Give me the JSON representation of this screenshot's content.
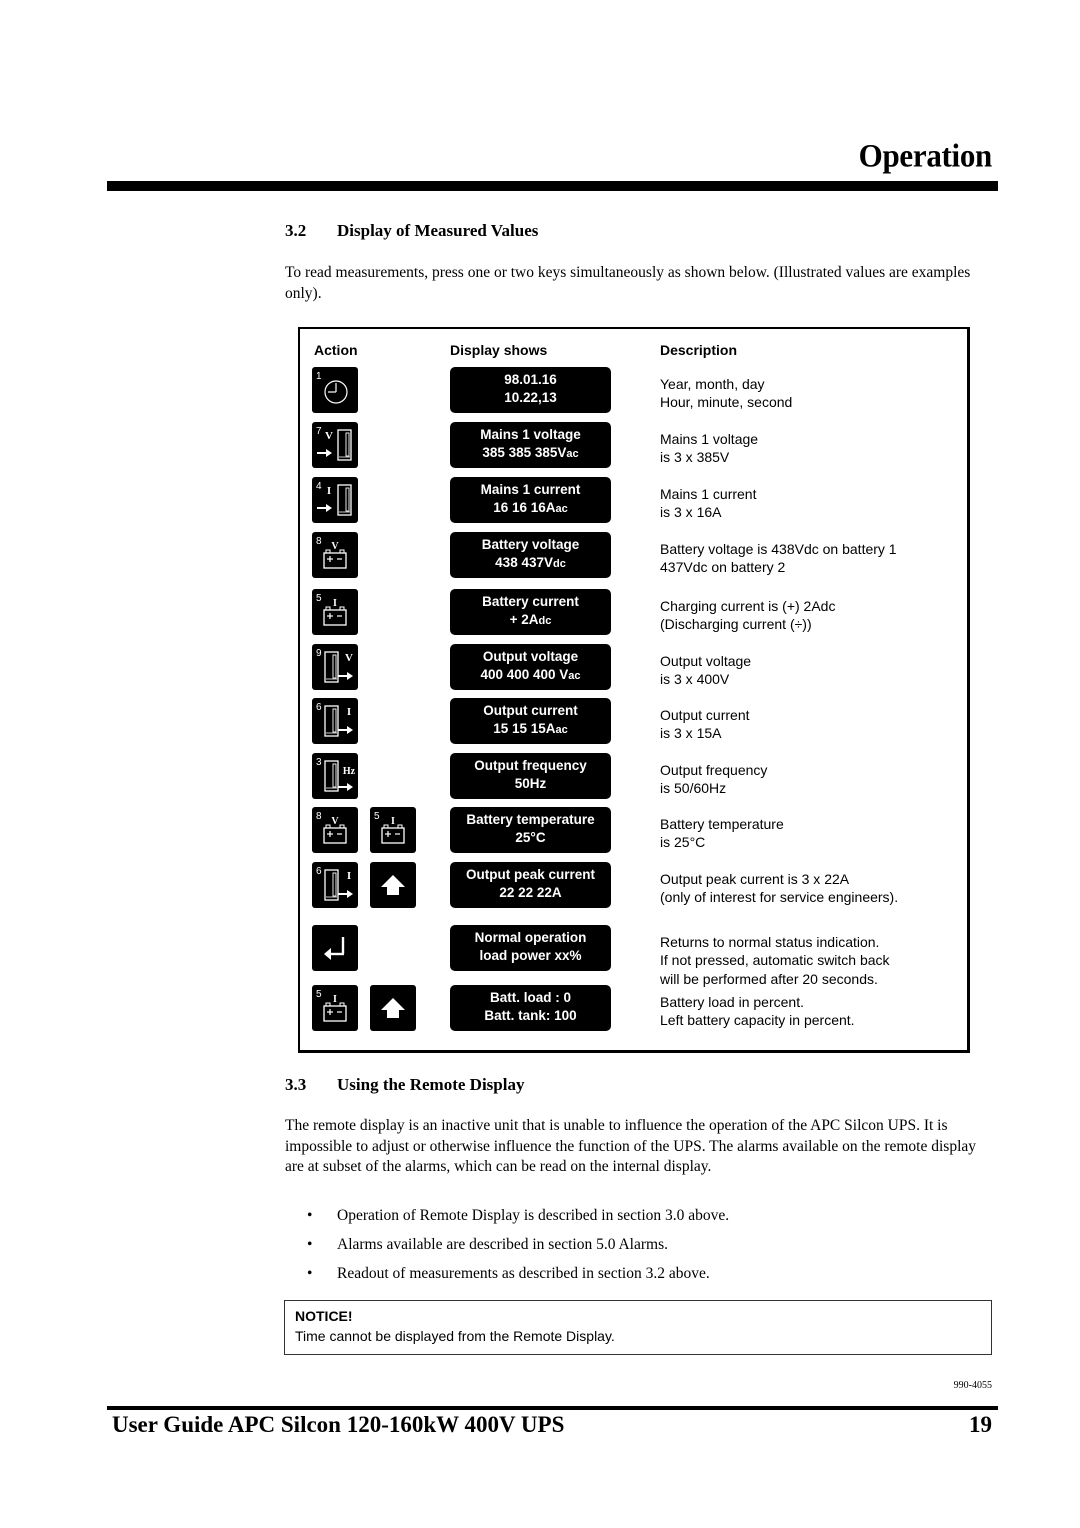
{
  "header": {
    "chapter_title": "Operation"
  },
  "section_3_2": {
    "number": "3.2",
    "title": "Display of Measured Values",
    "intro": "To read measurements, press one or two keys simultaneously as shown below. (Illustrated values are examples only).",
    "table": {
      "headers": {
        "action": "Action",
        "display": "Display shows",
        "description": "Description"
      },
      "rows": [
        {
          "keys": [
            {
              "icon": "clock-key-icon",
              "number": "1"
            }
          ],
          "display_line1": "98.01.16",
          "display_line2": "10.22,13",
          "desc_line1": "Year, month, day",
          "desc_line2": "Hour, minute, second"
        },
        {
          "keys": [
            {
              "icon": "mains-voltage-key-icon",
              "number": "7",
              "symbol": "V"
            }
          ],
          "display_line1": "Mains 1 voltage",
          "display_line2": "385 385 385Vac",
          "desc_line1": "Mains 1 voltage",
          "desc_line2": "is 3 x 385V"
        },
        {
          "keys": [
            {
              "icon": "mains-current-key-icon",
              "number": "4",
              "symbol": "I"
            }
          ],
          "display_line1": "Mains 1 current",
          "display_line2": "16 16 16Aac",
          "desc_line1": "Mains 1 current",
          "desc_line2": "is 3 x 16A"
        },
        {
          "keys": [
            {
              "icon": "battery-voltage-key-icon",
              "number": "8",
              "symbol": "V"
            }
          ],
          "display_line1": "Battery voltage",
          "display_line2": "438 437Vdc",
          "desc_line1": "Battery voltage is 438Vdc on battery 1",
          "desc_line2": "437Vdc on battery 2"
        },
        {
          "keys": [
            {
              "icon": "battery-current-key-icon",
              "number": "5",
              "symbol": "I"
            }
          ],
          "display_line1": "Battery current",
          "display_line2": "+ 2Adc",
          "desc_line1": "Charging current is (+) 2Adc",
          "desc_line2": "(Discharging current (÷))"
        },
        {
          "keys": [
            {
              "icon": "output-voltage-key-icon",
              "number": "9",
              "symbol": "V"
            }
          ],
          "display_line1": "Output voltage",
          "display_line2": "400 400 400 Vac",
          "desc_line1": "Output voltage",
          "desc_line2": "is 3 x 400V"
        },
        {
          "keys": [
            {
              "icon": "output-current-key-icon",
              "number": "6",
              "symbol": "I"
            }
          ],
          "display_line1": "Output current",
          "display_line2": "15 15 15Aac",
          "desc_line1": "Output current",
          "desc_line2": "is 3 x 15A"
        },
        {
          "keys": [
            {
              "icon": "output-frequency-key-icon",
              "number": "3",
              "symbol": "Hz"
            }
          ],
          "display_line1": "Output frequency",
          "display_line2": "50Hz",
          "desc_line1": "Output frequency",
          "desc_line2": "is 50/60Hz"
        },
        {
          "keys": [
            {
              "icon": "battery-voltage-key-icon",
              "number": "8",
              "symbol": "V"
            },
            {
              "icon": "battery-current-key-icon",
              "number": "5",
              "symbol": "I"
            }
          ],
          "display_line1": "Battery temperature",
          "display_line2": "25°C",
          "desc_line1": "Battery temperature",
          "desc_line2": "is 25°C"
        },
        {
          "keys": [
            {
              "icon": "output-current-key-icon",
              "number": "6",
              "symbol": "I"
            },
            {
              "icon": "up-arrow-key-icon"
            }
          ],
          "display_line1": "Output peak current",
          "display_line2": "22 22 22A",
          "desc_line1": "Output peak current is 3 x 22A",
          "desc_line2": "(only of interest for service engineers)."
        },
        {
          "keys": [
            {
              "icon": "enter-key-icon"
            }
          ],
          "display_line1": "Normal operation",
          "display_line2": "load power xx%",
          "desc_line1": "Returns to normal status indication.",
          "desc_line2": "If not pressed, automatic switch back",
          "desc_line3": "will be performed after 20 seconds."
        },
        {
          "keys": [
            {
              "icon": "battery-current-key-icon",
              "number": "5",
              "symbol": "I"
            },
            {
              "icon": "up-arrow-key-icon"
            }
          ],
          "display_line1": "Batt. load : 0",
          "display_line2": "Batt. tank:  100",
          "desc_line1": "Battery load in percent.",
          "desc_line2": "Left battery capacity in percent."
        }
      ]
    }
  },
  "section_3_3": {
    "number": "3.3",
    "title": "Using the Remote Display",
    "paragraph": "The remote display is an inactive unit that is unable to influence the operation of the APC Silcon UPS. It is impossible to adjust or otherwise influence the function of the UPS. The alarms available on the remote display are at subset of the alarms, which can be read on the internal display.",
    "bullets": [
      "Operation of Remote Display is described in section 3.0 above.",
      "Alarms available are described in section 5.0 Alarms.",
      "Readout of measurements as described in section 3.2 above."
    ],
    "bullet_glyph": "•"
  },
  "notice": {
    "title": "NOTICE!",
    "text": "Time cannot be displayed from the Remote Display."
  },
  "footer": {
    "doc_number": "990-4055",
    "title": "User Guide APC Silcon 120-160kW 400V UPS",
    "page_number": "19"
  }
}
